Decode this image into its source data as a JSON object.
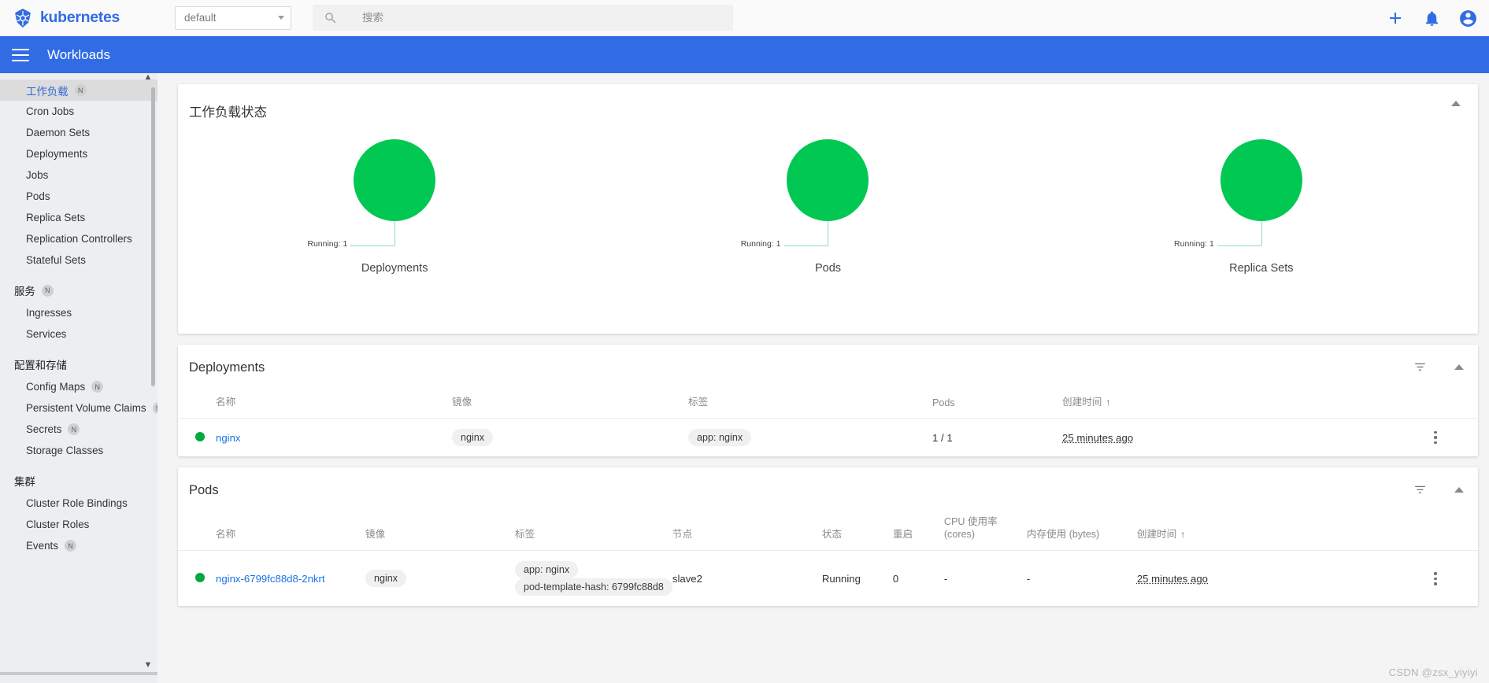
{
  "topbar": {
    "brand": "kubernetes",
    "namespace_selected": "default",
    "search_placeholder": "搜索",
    "search_value": "",
    "icons": {
      "add": "plus-icon",
      "notifications": "bell-icon",
      "account": "account-circle-icon"
    }
  },
  "subheader": {
    "title": "Workloads",
    "menu_icon": "hamburger-icon"
  },
  "sidebar": {
    "sections": [
      {
        "group": null,
        "items": [
          {
            "label": "工作负载",
            "badge": "N",
            "active": true
          },
          {
            "label": "Cron Jobs",
            "badge": null,
            "active": false
          },
          {
            "label": "Daemon Sets",
            "badge": null,
            "active": false
          },
          {
            "label": "Deployments",
            "badge": null,
            "active": false
          },
          {
            "label": "Jobs",
            "badge": null,
            "active": false
          },
          {
            "label": "Pods",
            "badge": null,
            "active": false
          },
          {
            "label": "Replica Sets",
            "badge": null,
            "active": false
          },
          {
            "label": "Replication Controllers",
            "badge": null,
            "active": false
          },
          {
            "label": "Stateful Sets",
            "badge": null,
            "active": false
          }
        ]
      },
      {
        "group": "服务",
        "group_badge": "N",
        "items": [
          {
            "label": "Ingresses",
            "badge": null,
            "active": false
          },
          {
            "label": "Services",
            "badge": null,
            "active": false
          }
        ]
      },
      {
        "group": "配置和存储",
        "group_badge": null,
        "items": [
          {
            "label": "Config Maps",
            "badge": "N",
            "active": false
          },
          {
            "label": "Persistent Volume Claims",
            "badge": "N",
            "active": false
          },
          {
            "label": "Secrets",
            "badge": "N",
            "active": false
          },
          {
            "label": "Storage Classes",
            "badge": null,
            "active": false
          }
        ]
      },
      {
        "group": "集群",
        "group_badge": null,
        "items": [
          {
            "label": "Cluster Role Bindings",
            "badge": null,
            "active": false
          },
          {
            "label": "Cluster Roles",
            "badge": null,
            "active": false
          },
          {
            "label": "Events",
            "badge": "N",
            "active": false
          }
        ]
      }
    ]
  },
  "status_card": {
    "title": "工作负载状态",
    "graphs": [
      {
        "name": "Deployments",
        "legend": "Running: 1",
        "running": 1,
        "color": "#00c853"
      },
      {
        "name": "Pods",
        "legend": "Running: 1",
        "running": 1,
        "color": "#00c853"
      },
      {
        "name": "Replica Sets",
        "legend": "Running: 1",
        "running": 1,
        "color": "#00c853"
      }
    ]
  },
  "deployments_card": {
    "title": "Deployments",
    "columns": [
      "名称",
      "镜像",
      "标签",
      "Pods",
      "创建时间"
    ],
    "sort_column": "创建时间",
    "sort_direction": "asc",
    "rows": [
      {
        "status": "green",
        "name": "nginx",
        "image": "nginx",
        "labels": [
          "app: nginx"
        ],
        "pods": "1 / 1",
        "created": "25 minutes ago"
      }
    ]
  },
  "pods_card": {
    "title": "Pods",
    "columns": [
      "名称",
      "镜像",
      "标签",
      "节点",
      "状态",
      "重启",
      "CPU 使用率 (cores)",
      "内存使用 (bytes)",
      "创建时间"
    ],
    "cpu_col_line1": "CPU 使用率",
    "cpu_col_line2": "(cores)",
    "sort_column": "创建时间",
    "sort_direction": "asc",
    "rows": [
      {
        "status": "green",
        "name": "nginx-6799fc88d8-2nkrt",
        "image": "nginx",
        "labels": [
          "app: nginx",
          "pod-template-hash: 6799fc88d8"
        ],
        "node": "slave2",
        "state": "Running",
        "restarts": "0",
        "cpu": "-",
        "memory": "-",
        "created": "25 minutes ago"
      }
    ]
  },
  "watermark": "CSDN @zsx_yiyiyi",
  "colors": {
    "brand": "#326ce5",
    "running": "#00c853",
    "link": "#1a73e8"
  }
}
